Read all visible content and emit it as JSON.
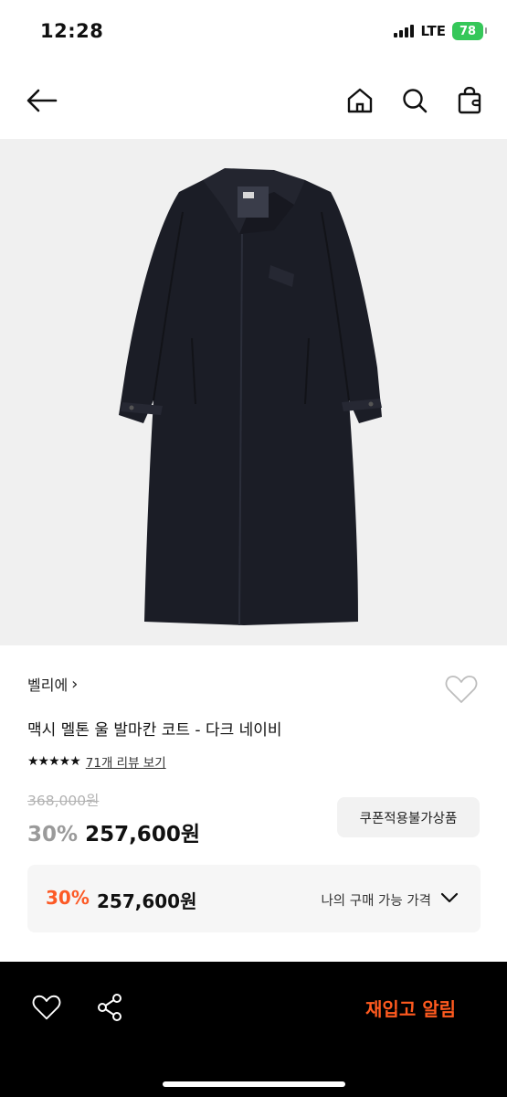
{
  "status_bar": {
    "time": "12:28",
    "network": "LTE",
    "battery": "78"
  },
  "nav": {
    "back_icon": "arrow-left-icon",
    "home_icon": "home-icon",
    "search_icon": "search-icon",
    "cart_icon": "shopping-bag-icon"
  },
  "product": {
    "image_alt": "navy coat",
    "brand": "벨리에",
    "brand_chevron": "›",
    "name": "맥시 멜톤 울 발마칸 코트 - 다크 네이비",
    "stars": "★★★★★",
    "rating": 5,
    "review_link": "71개 리뷰 보기",
    "original_price": "368,000원",
    "discount": "30%",
    "price": "257,600원",
    "coupon_badge": "쿠폰적용불가상품"
  },
  "my_price": {
    "discount": "30%",
    "price": "257,600원",
    "label": "나의 구매 가능 가격"
  },
  "bottom_bar": {
    "restock_label": "재입고 알림"
  },
  "colors": {
    "accent": "#fc5a26",
    "bottom_bar": "#000000",
    "battery": "#35c759"
  }
}
